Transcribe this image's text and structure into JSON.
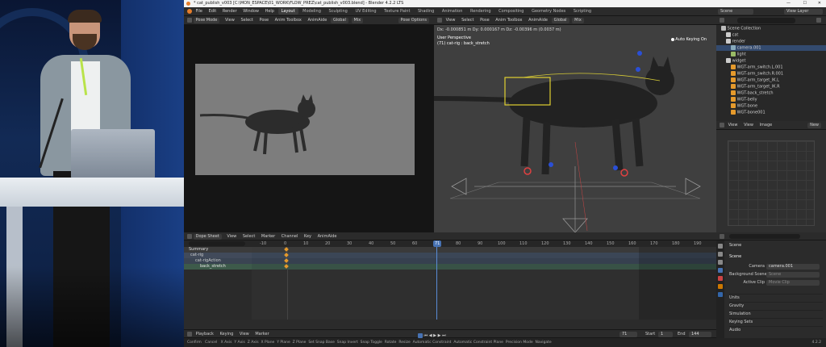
{
  "titlebar": {
    "text": "* cat_publish_v003 [C:\\MON_ESPACE\\01_WORK\\FLOW_PREZ\\cat_publish_v003.blend] - Blender 4.2.2 LTS",
    "min": "—",
    "max": "☐",
    "close": "✕"
  },
  "menu": [
    "File",
    "Edit",
    "Render",
    "Window",
    "Help"
  ],
  "workspaces": [
    "Layout",
    "Modeling",
    "Sculpting",
    "UV Editing",
    "Texture Paint",
    "Shading",
    "Animation",
    "Rendering",
    "Compositing",
    "Geometry Nodes",
    "Scripting"
  ],
  "scene": {
    "label": "Scene",
    "view_layer": "View Layer"
  },
  "left_header": {
    "mode": "Pose Mode",
    "items": [
      "View",
      "Select",
      "Pose",
      "Anim Toolbox",
      "AnimAide"
    ],
    "orientation": "Global",
    "mix": "Mix",
    "pose_options": "Pose Options"
  },
  "viewport": {
    "items": [
      "View",
      "Select",
      "Pose",
      "Anim Toolbox",
      "AnimAide"
    ],
    "orientation": "Global",
    "mix": "Mix",
    "title": "User Perspective",
    "subtitle": "(71) cat-rig : back_stretch",
    "readout": "Dx: -0.000851 m   Dy: 0.000167 m   Dz: -0.00396 m (0.0037 m)",
    "auto_key": "Auto Keying On"
  },
  "outliner": {
    "search": "",
    "collection": "Scene Collection",
    "items": [
      {
        "name": "cat",
        "level": 1
      },
      {
        "name": "render",
        "level": 1
      },
      {
        "name": "camera.001",
        "level": 2
      },
      {
        "name": "light",
        "level": 2
      },
      {
        "name": "widget",
        "level": 1
      },
      {
        "name": "WGT-arm_switch.L.001",
        "level": 2
      },
      {
        "name": "WGT-arm_switch.R.001",
        "level": 2
      },
      {
        "name": "WGT-arm_target_IK.L",
        "level": 2
      },
      {
        "name": "WGT-arm_target_IK.R",
        "level": 2
      },
      {
        "name": "WGT-back_stretch",
        "level": 2
      },
      {
        "name": "WGT-belly",
        "level": 2
      },
      {
        "name": "WGT-bone",
        "level": 2
      },
      {
        "name": "WGT-bone001",
        "level": 2
      }
    ]
  },
  "image_editor": {
    "items": [
      "View",
      "View",
      "Image"
    ],
    "new": "New"
  },
  "dopesheet": {
    "mode": "Dope Sheet",
    "items": [
      "View",
      "Select",
      "Marker",
      "Channel",
      "Key",
      "AnimAide"
    ],
    "search": "",
    "ticks": [
      "-10",
      "0",
      "10",
      "20",
      "30",
      "40",
      "50",
      "60",
      "71",
      "80",
      "90",
      "100",
      "110",
      "120",
      "130",
      "140",
      "150",
      "160",
      "170",
      "180",
      "190"
    ],
    "current_frame": "71",
    "channels": [
      "Summary",
      "cat-rig",
      "cat-rigAction",
      "back_stretch"
    ]
  },
  "timeline": {
    "items": [
      "Playback",
      "Keying",
      "View",
      "Marker"
    ],
    "frame": "71",
    "start_label": "Start",
    "start": "1",
    "end_label": "End",
    "end": "144"
  },
  "properties": {
    "search": "",
    "tab": "Scene",
    "section": "Scene",
    "camera_label": "Camera",
    "camera": "camera.001",
    "bg_label": "Background Scene",
    "bg": "Scene",
    "clip_label": "Active Clip",
    "clip": "Movie Clip",
    "panels": [
      "Units",
      "Gravity",
      "Simulation",
      "Keying Sets",
      "Audio"
    ]
  },
  "statusbar": {
    "items": [
      "Confirm",
      "Cancel",
      "X Axis",
      "Y Axis",
      "Z Axis",
      "X Plane",
      "Y Plane",
      "Z Plane",
      "Set Snap Base",
      "Snap Invert",
      "Snap Toggle",
      "Rotate",
      "Resize",
      "Automatic Constraint",
      "Automatic Constraint Plane",
      "Precision Mode",
      "Navigate"
    ],
    "version": "4.2.2"
  },
  "colors": {
    "accent": "#4772b3",
    "orange": "#e59a2c",
    "frame": "#5a8cd6"
  }
}
